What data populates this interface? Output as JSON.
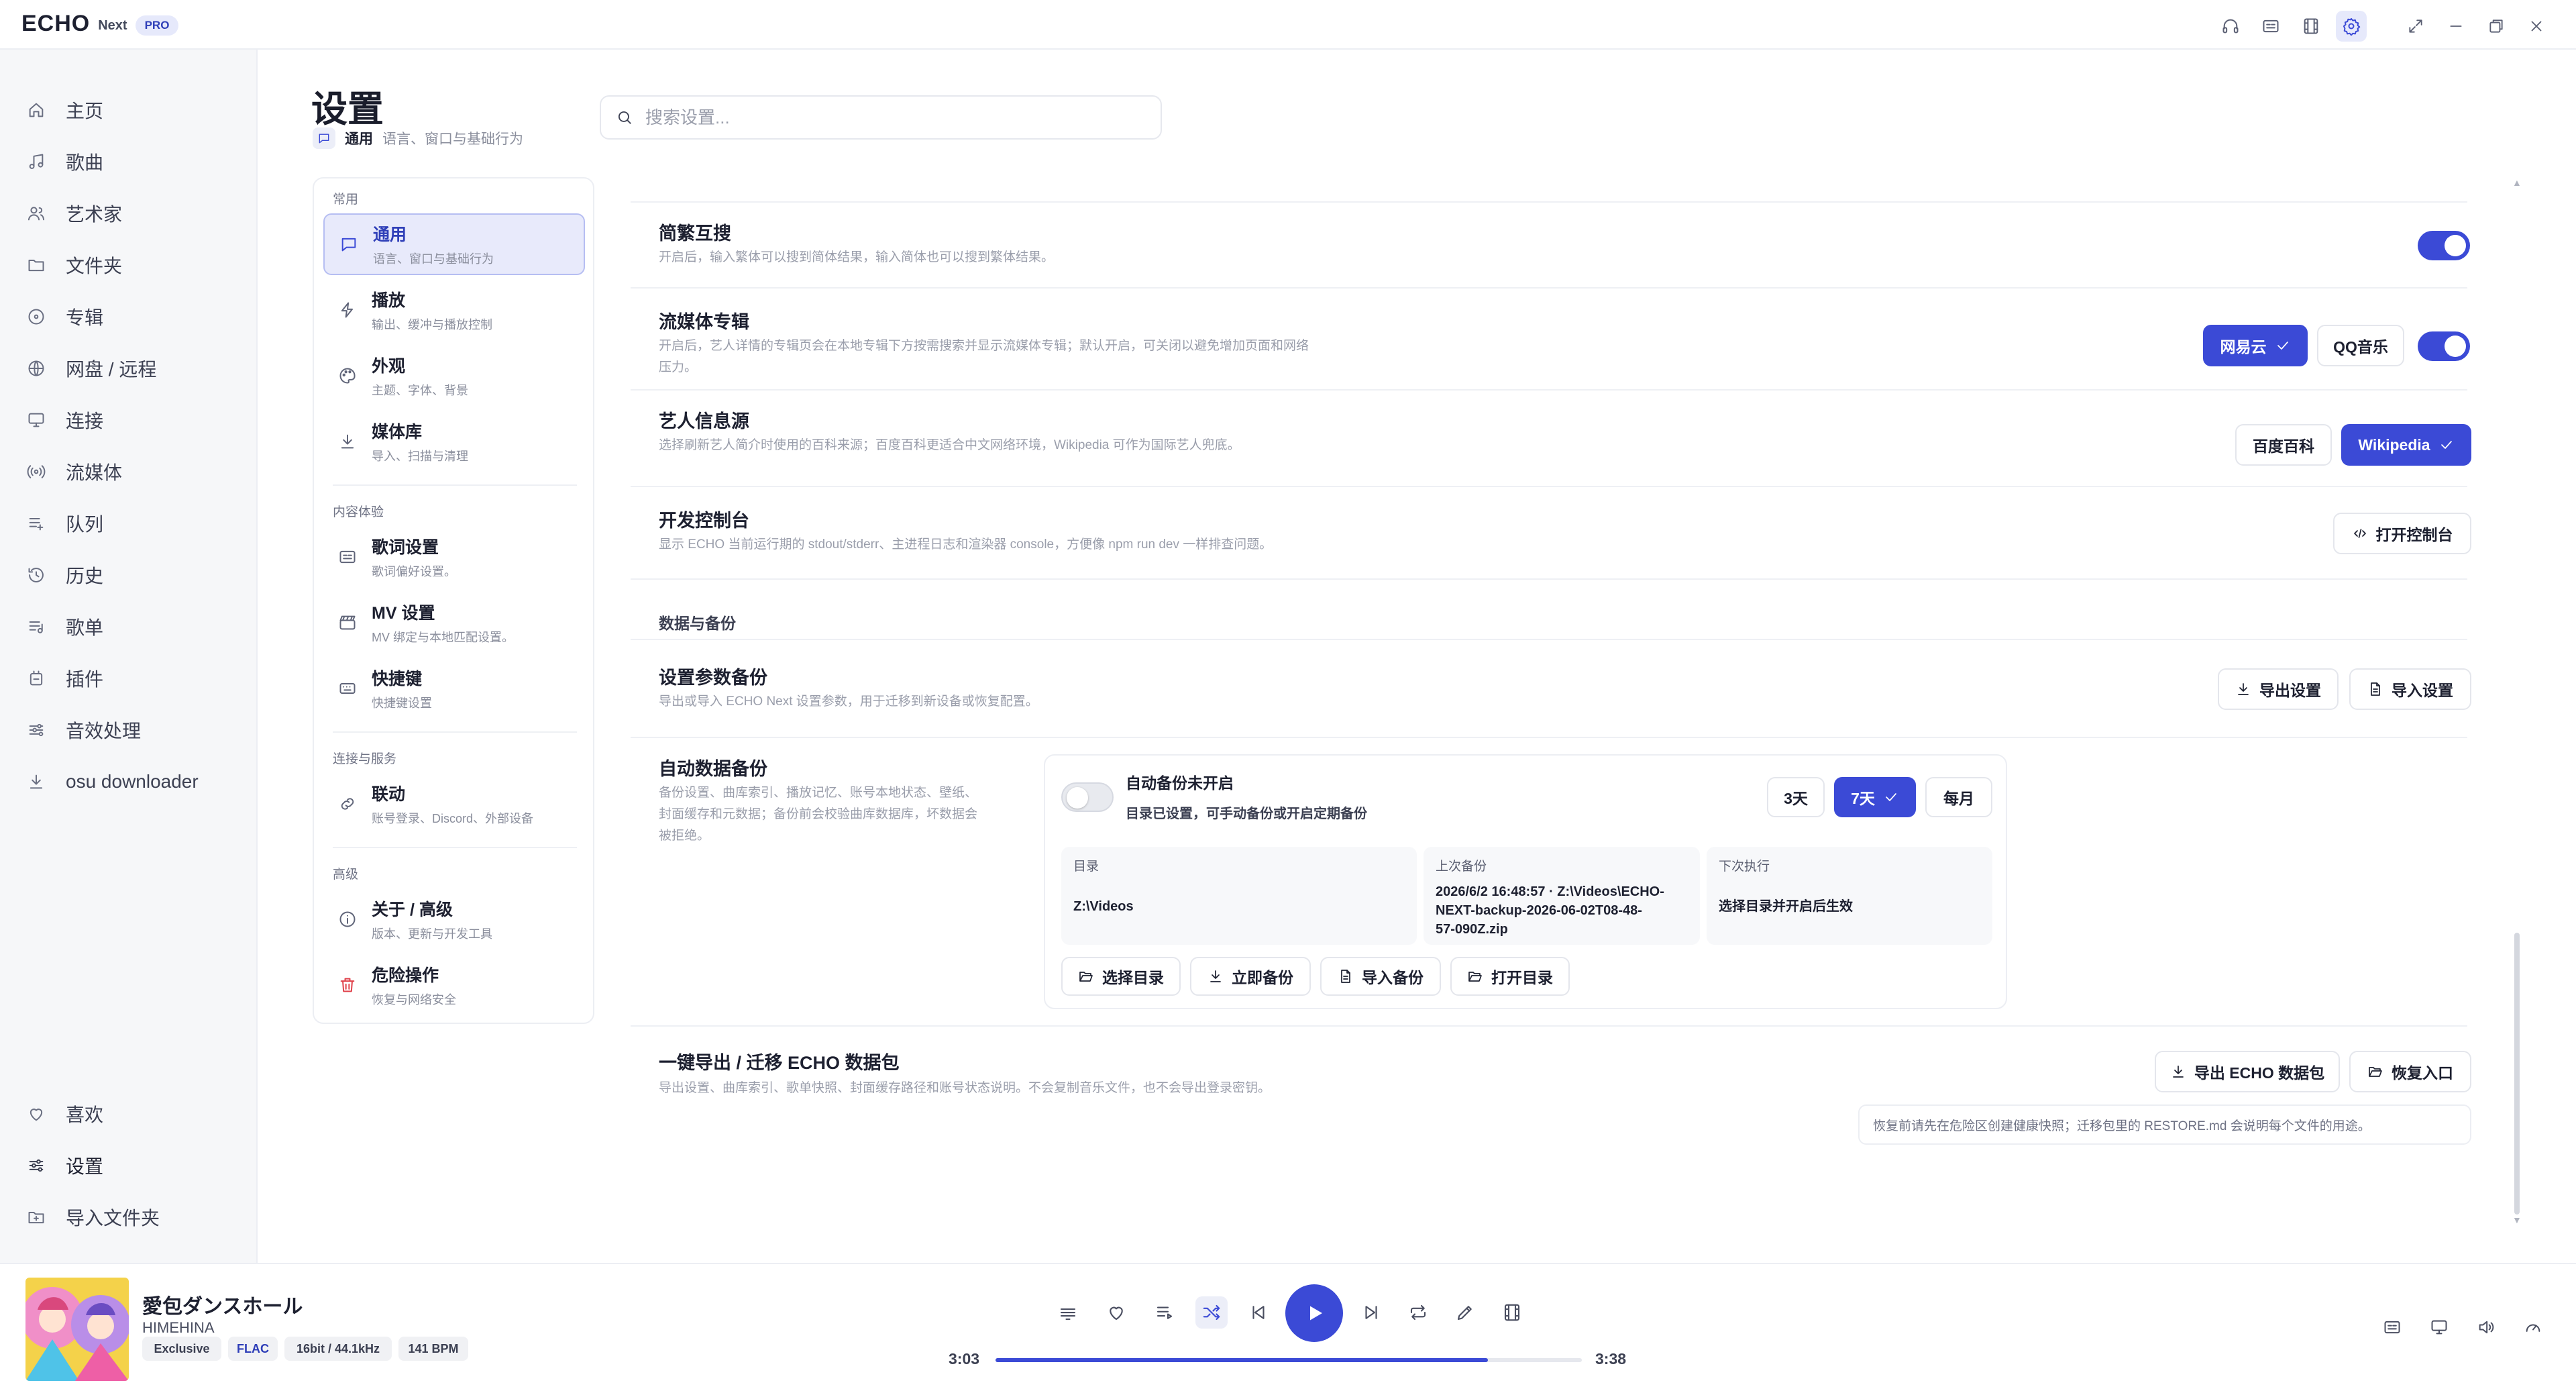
{
  "app": {
    "name": "ECHO",
    "edition": "Next",
    "badge": "PRO"
  },
  "sidebar": {
    "items": [
      {
        "label": "主页",
        "icon": "home-icon"
      },
      {
        "label": "歌曲",
        "icon": "music-note-icon"
      },
      {
        "label": "艺术家",
        "icon": "users-icon"
      },
      {
        "label": "文件夹",
        "icon": "folder-icon"
      },
      {
        "label": "专辑",
        "icon": "disc-icon"
      },
      {
        "label": "网盘 / 远程",
        "icon": "globe-icon"
      },
      {
        "label": "连接",
        "icon": "monitor-icon"
      },
      {
        "label": "流媒体",
        "icon": "broadcast-icon"
      },
      {
        "label": "队列",
        "icon": "list-icon"
      },
      {
        "label": "历史",
        "icon": "history-icon"
      },
      {
        "label": "歌单",
        "icon": "playlist-icon"
      },
      {
        "label": "插件",
        "icon": "plugin-icon"
      },
      {
        "label": "音效处理",
        "icon": "equalizer-icon"
      },
      {
        "label": "osu downloader",
        "icon": "download-icon"
      }
    ],
    "bottom": [
      {
        "label": "喜欢",
        "icon": "heart-icon"
      },
      {
        "label": "设置",
        "icon": "sliders-icon"
      },
      {
        "label": "导入文件夹",
        "icon": "folder-plus-icon"
      }
    ]
  },
  "header": {
    "title": "设置",
    "tag": "通用",
    "tag_desc": "语言、窗口与基础行为",
    "search_placeholder": "搜索设置..."
  },
  "categories": {
    "group_common": "常用",
    "group_content": "内容体验",
    "group_connect": "连接与服务",
    "group_advanced": "高级",
    "items": [
      {
        "title": "通用",
        "desc": "语言、窗口与基础行为"
      },
      {
        "title": "播放",
        "desc": "输出、缓冲与播放控制"
      },
      {
        "title": "外观",
        "desc": "主题、字体、背景"
      },
      {
        "title": "媒体库",
        "desc": "导入、扫描与清理"
      },
      {
        "title": "歌词设置",
        "desc": "歌词偏好设置。"
      },
      {
        "title": "MV 设置",
        "desc": "MV 绑定与本地匹配设置。"
      },
      {
        "title": "快捷键",
        "desc": "快捷键设置"
      },
      {
        "title": "联动",
        "desc": "账号登录、Discord、外部设备"
      },
      {
        "title": "关于 / 高级",
        "desc": "版本、更新与开发工具"
      },
      {
        "title": "危险操作",
        "desc": "恢复与网络安全"
      }
    ]
  },
  "settings": {
    "simp_trad": {
      "title": "简繁互搜",
      "desc": "开启后，输入繁体可以搜到简体结果，输入简体也可以搜到繁体结果。",
      "enabled": true
    },
    "stream_album": {
      "title": "流媒体专辑",
      "desc_line1": "开启后，艺人详情的专辑页会在本地专辑下方按需搜索并显示流媒体专辑；默认开启，可关闭以避免增加页面和网络",
      "desc_line2": "压力。",
      "btn_netease": "网易云",
      "btn_qq": "QQ音乐",
      "enabled": true
    },
    "artist_source": {
      "title": "艺人信息源",
      "desc": "选择刷新艺人简介时使用的百科来源；百度百科更适合中文网络环境，Wikipedia 可作为国际艺人兜底。",
      "btn_baidu": "百度百科",
      "btn_wiki": "Wikipedia"
    },
    "dev_console": {
      "title": "开发控制台",
      "desc": "显示 ECHO 当前运行期的 stdout/stderr、主进程日志和渲染器 console，方便像 npm run dev 一样排查问题。",
      "btn": "打开控制台"
    },
    "data_section": "数据与备份",
    "param_backup": {
      "title": "设置参数备份",
      "desc": "导出或导入 ECHO Next 设置参数，用于迁移到新设备或恢复配置。",
      "btn_export": "导出设置",
      "btn_import": "导入设置"
    },
    "auto_backup": {
      "title": "自动数据备份",
      "desc_line1": "备份设置、曲库索引、播放记忆、账号本地状态、壁纸、",
      "desc_line2": "封面缓存和元数据；备份前会校验曲库数据库，坏数据会",
      "desc_line3": "被拒绝。",
      "status_title": "自动备份未开启",
      "status_desc": "目录已设置，可手动备份或开启定期备份",
      "freq_3": "3天",
      "freq_7": "7天",
      "freq_month": "每月",
      "dir_label": "目录",
      "dir_value": "Z:\\Videos",
      "last_label": "上次备份",
      "last_value_line1": "2026/6/2 16:48:57 · Z:\\Videos\\ECHO-",
      "last_value_line2": "NEXT-backup-2026-06-02T08-48-",
      "last_value_line3": "57-090Z.zip",
      "next_label": "下次执行",
      "next_value": "选择目录并开启后生效",
      "btn_choose": "选择目录",
      "btn_now": "立即备份",
      "btn_import": "导入备份",
      "btn_open": "打开目录",
      "enabled": false
    },
    "export_pkg": {
      "title": "一键导出 / 迁移 ECHO 数据包",
      "desc": "导出设置、曲库索引、歌单快照、封面缓存路径和账号状态说明。不会复制音乐文件，也不会导出登录密钥。",
      "btn_export": "导出 ECHO 数据包",
      "btn_restore": "恢复入口",
      "note": "恢复前请先在危险区创建健康快照；迁移包里的 RESTORE.md 会说明每个文件的用途。"
    }
  },
  "player": {
    "title": "愛包ダンスホール",
    "artist": "HIMEHINA",
    "badges": [
      "Exclusive",
      "FLAC",
      "16bit / 44.1kHz",
      "141 BPM"
    ],
    "current_time": "3:03",
    "total_time": "3:38",
    "progress": 0.84
  },
  "colors": {
    "accent": "#3b4ad6",
    "danger": "#e0414a"
  }
}
